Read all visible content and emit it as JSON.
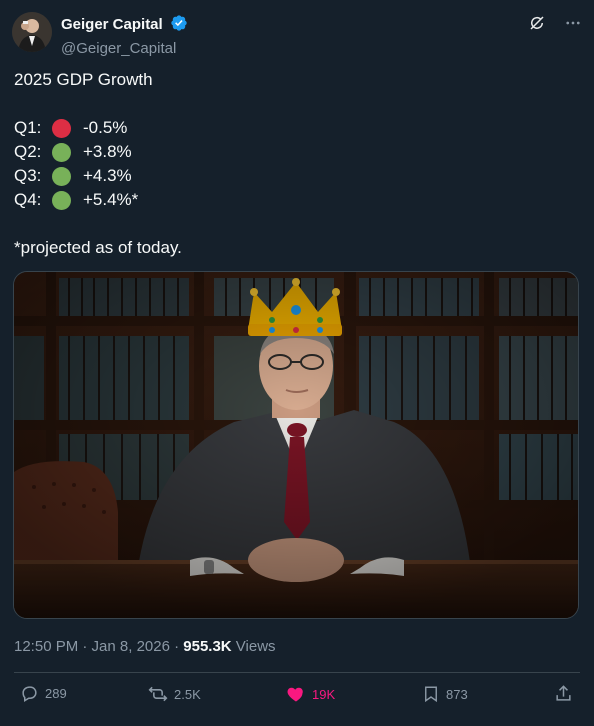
{
  "author": {
    "name": "Geiger Capital",
    "handle": "@Geiger_Capital",
    "verified": true
  },
  "icons": {
    "verified": "verified-badge-icon",
    "grok": "grok-icon",
    "more": "more-icon",
    "reply": "reply-icon",
    "repost": "repost-icon",
    "like": "heart-icon",
    "bookmark": "bookmark-icon",
    "share": "share-icon"
  },
  "post": {
    "title": "2025 GDP Growth",
    "quarters": [
      {
        "label": "Q1:",
        "status": "red",
        "value": "-0.5%"
      },
      {
        "label": "Q2:",
        "status": "green",
        "value": "+3.8%"
      },
      {
        "label": "Q3:",
        "status": "green",
        "value": "+4.3%"
      },
      {
        "label": "Q4:",
        "status": "green",
        "value": "+5.4%*"
      }
    ],
    "footnote": "*projected as of today."
  },
  "meta": {
    "time": "12:50 PM · Jan 8, 2026 · ",
    "views_count": "955.3K",
    "views_label": " Views"
  },
  "actions": {
    "replies": "289",
    "reposts": "2.5K",
    "likes": "19K",
    "bookmarks": "873"
  },
  "colors": {
    "background": "#15202b",
    "text": "#f7f9f9",
    "muted": "#8b98a5",
    "like": "#f91880",
    "verified": "#1d9bf0"
  }
}
